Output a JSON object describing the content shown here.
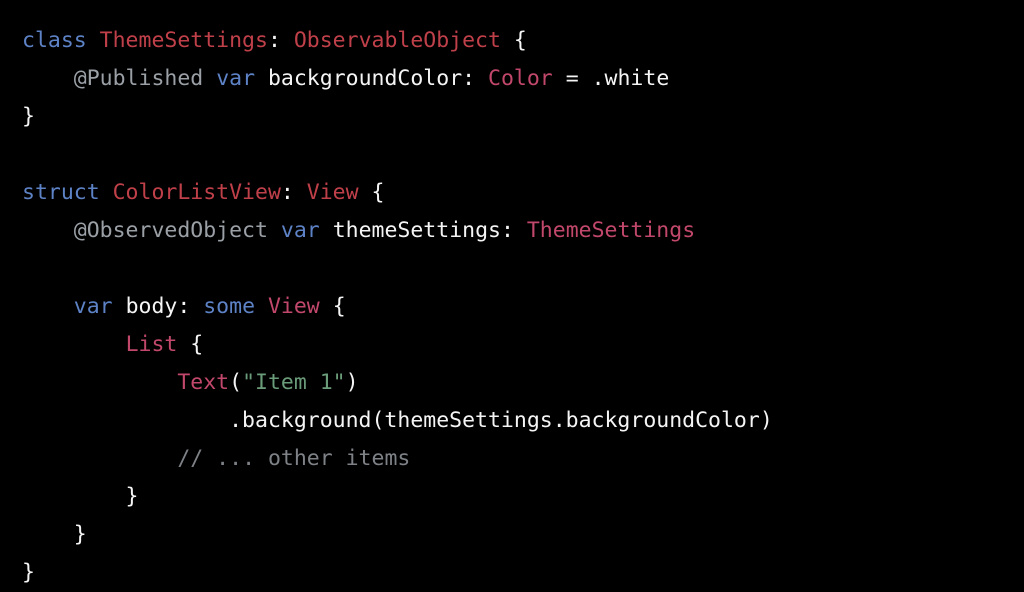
{
  "editor": {
    "language": "Swift",
    "background_color": "#000000",
    "default_text_color": "#f2f2f2",
    "palette": {
      "keyword": "#5d82c6",
      "type": "#c0404a",
      "type_alt": "#c2486b",
      "attribute": "#9aa0a6",
      "string": "#6b9c7a",
      "comment": "#7e8287",
      "plain": "#f5f5f5"
    }
  },
  "code": {
    "lines": [
      {
        "id": "line-1",
        "tokens": [
          {
            "text": "class ",
            "kind": "keyword"
          },
          {
            "text": "ThemeSettings",
            "kind": "type"
          },
          {
            "text": ": ",
            "kind": "plain"
          },
          {
            "text": "ObservableObject",
            "kind": "type"
          },
          {
            "text": " {",
            "kind": "plain"
          }
        ]
      },
      {
        "id": "line-2",
        "tokens": [
          {
            "text": "    ",
            "kind": "plain"
          },
          {
            "text": "@Published",
            "kind": "attribute"
          },
          {
            "text": " ",
            "kind": "plain"
          },
          {
            "text": "var",
            "kind": "keyword"
          },
          {
            "text": " backgroundColor: ",
            "kind": "plain"
          },
          {
            "text": "Color",
            "kind": "type_alt"
          },
          {
            "text": " = .white",
            "kind": "plain"
          }
        ]
      },
      {
        "id": "line-3",
        "tokens": [
          {
            "text": "}",
            "kind": "plain"
          }
        ]
      },
      {
        "id": "line-4",
        "tokens": []
      },
      {
        "id": "line-5",
        "tokens": [
          {
            "text": "struct ",
            "kind": "keyword"
          },
          {
            "text": "ColorListView",
            "kind": "type"
          },
          {
            "text": ": ",
            "kind": "plain"
          },
          {
            "text": "View",
            "kind": "type"
          },
          {
            "text": " {",
            "kind": "plain"
          }
        ]
      },
      {
        "id": "line-6",
        "tokens": [
          {
            "text": "    ",
            "kind": "plain"
          },
          {
            "text": "@ObservedObject",
            "kind": "attribute"
          },
          {
            "text": " ",
            "kind": "plain"
          },
          {
            "text": "var",
            "kind": "keyword"
          },
          {
            "text": " themeSettings: ",
            "kind": "plain"
          },
          {
            "text": "ThemeSettings",
            "kind": "type_alt"
          }
        ]
      },
      {
        "id": "line-7",
        "tokens": []
      },
      {
        "id": "line-8",
        "tokens": [
          {
            "text": "    ",
            "kind": "plain"
          },
          {
            "text": "var",
            "kind": "keyword"
          },
          {
            "text": " body: ",
            "kind": "plain"
          },
          {
            "text": "some",
            "kind": "keyword"
          },
          {
            "text": " ",
            "kind": "plain"
          },
          {
            "text": "View",
            "kind": "type_alt"
          },
          {
            "text": " {",
            "kind": "plain"
          }
        ]
      },
      {
        "id": "line-9",
        "tokens": [
          {
            "text": "        ",
            "kind": "plain"
          },
          {
            "text": "List",
            "kind": "type_alt"
          },
          {
            "text": " {",
            "kind": "plain"
          }
        ]
      },
      {
        "id": "line-10",
        "tokens": [
          {
            "text": "            ",
            "kind": "plain"
          },
          {
            "text": "Text",
            "kind": "type_alt"
          },
          {
            "text": "(",
            "kind": "plain"
          },
          {
            "text": "\"Item 1\"",
            "kind": "string"
          },
          {
            "text": ")",
            "kind": "plain"
          }
        ]
      },
      {
        "id": "line-11",
        "tokens": [
          {
            "text": "                .background(themeSettings.backgroundColor)",
            "kind": "plain"
          }
        ]
      },
      {
        "id": "line-12",
        "tokens": [
          {
            "text": "            ",
            "kind": "plain"
          },
          {
            "text": "// ... other items",
            "kind": "comment"
          }
        ]
      },
      {
        "id": "line-13",
        "tokens": [
          {
            "text": "        }",
            "kind": "plain"
          }
        ]
      },
      {
        "id": "line-14",
        "tokens": [
          {
            "text": "    }",
            "kind": "plain"
          }
        ]
      },
      {
        "id": "line-15",
        "tokens": [
          {
            "text": "}",
            "kind": "plain"
          }
        ]
      }
    ]
  }
}
